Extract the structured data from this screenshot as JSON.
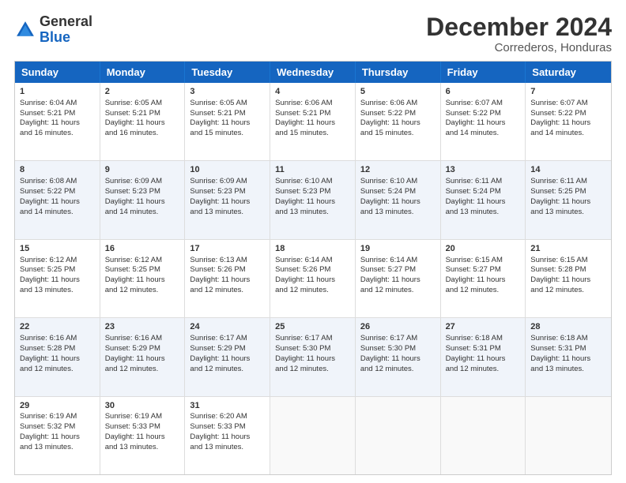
{
  "logo": {
    "general": "General",
    "blue": "Blue"
  },
  "title": "December 2024",
  "location": "Correderos, Honduras",
  "days_of_week": [
    "Sunday",
    "Monday",
    "Tuesday",
    "Wednesday",
    "Thursday",
    "Friday",
    "Saturday"
  ],
  "weeks": [
    [
      {
        "day": 1,
        "lines": [
          "Sunrise: 6:04 AM",
          "Sunset: 5:21 PM",
          "Daylight: 11 hours",
          "and 16 minutes."
        ]
      },
      {
        "day": 2,
        "lines": [
          "Sunrise: 6:05 AM",
          "Sunset: 5:21 PM",
          "Daylight: 11 hours",
          "and 16 minutes."
        ]
      },
      {
        "day": 3,
        "lines": [
          "Sunrise: 6:05 AM",
          "Sunset: 5:21 PM",
          "Daylight: 11 hours",
          "and 15 minutes."
        ]
      },
      {
        "day": 4,
        "lines": [
          "Sunrise: 6:06 AM",
          "Sunset: 5:21 PM",
          "Daylight: 11 hours",
          "and 15 minutes."
        ]
      },
      {
        "day": 5,
        "lines": [
          "Sunrise: 6:06 AM",
          "Sunset: 5:22 PM",
          "Daylight: 11 hours",
          "and 15 minutes."
        ]
      },
      {
        "day": 6,
        "lines": [
          "Sunrise: 6:07 AM",
          "Sunset: 5:22 PM",
          "Daylight: 11 hours",
          "and 14 minutes."
        ]
      },
      {
        "day": 7,
        "lines": [
          "Sunrise: 6:07 AM",
          "Sunset: 5:22 PM",
          "Daylight: 11 hours",
          "and 14 minutes."
        ]
      }
    ],
    [
      {
        "day": 8,
        "lines": [
          "Sunrise: 6:08 AM",
          "Sunset: 5:22 PM",
          "Daylight: 11 hours",
          "and 14 minutes."
        ]
      },
      {
        "day": 9,
        "lines": [
          "Sunrise: 6:09 AM",
          "Sunset: 5:23 PM",
          "Daylight: 11 hours",
          "and 14 minutes."
        ]
      },
      {
        "day": 10,
        "lines": [
          "Sunrise: 6:09 AM",
          "Sunset: 5:23 PM",
          "Daylight: 11 hours",
          "and 13 minutes."
        ]
      },
      {
        "day": 11,
        "lines": [
          "Sunrise: 6:10 AM",
          "Sunset: 5:23 PM",
          "Daylight: 11 hours",
          "and 13 minutes."
        ]
      },
      {
        "day": 12,
        "lines": [
          "Sunrise: 6:10 AM",
          "Sunset: 5:24 PM",
          "Daylight: 11 hours",
          "and 13 minutes."
        ]
      },
      {
        "day": 13,
        "lines": [
          "Sunrise: 6:11 AM",
          "Sunset: 5:24 PM",
          "Daylight: 11 hours",
          "and 13 minutes."
        ]
      },
      {
        "day": 14,
        "lines": [
          "Sunrise: 6:11 AM",
          "Sunset: 5:25 PM",
          "Daylight: 11 hours",
          "and 13 minutes."
        ]
      }
    ],
    [
      {
        "day": 15,
        "lines": [
          "Sunrise: 6:12 AM",
          "Sunset: 5:25 PM",
          "Daylight: 11 hours",
          "and 13 minutes."
        ]
      },
      {
        "day": 16,
        "lines": [
          "Sunrise: 6:12 AM",
          "Sunset: 5:25 PM",
          "Daylight: 11 hours",
          "and 12 minutes."
        ]
      },
      {
        "day": 17,
        "lines": [
          "Sunrise: 6:13 AM",
          "Sunset: 5:26 PM",
          "Daylight: 11 hours",
          "and 12 minutes."
        ]
      },
      {
        "day": 18,
        "lines": [
          "Sunrise: 6:14 AM",
          "Sunset: 5:26 PM",
          "Daylight: 11 hours",
          "and 12 minutes."
        ]
      },
      {
        "day": 19,
        "lines": [
          "Sunrise: 6:14 AM",
          "Sunset: 5:27 PM",
          "Daylight: 11 hours",
          "and 12 minutes."
        ]
      },
      {
        "day": 20,
        "lines": [
          "Sunrise: 6:15 AM",
          "Sunset: 5:27 PM",
          "Daylight: 11 hours",
          "and 12 minutes."
        ]
      },
      {
        "day": 21,
        "lines": [
          "Sunrise: 6:15 AM",
          "Sunset: 5:28 PM",
          "Daylight: 11 hours",
          "and 12 minutes."
        ]
      }
    ],
    [
      {
        "day": 22,
        "lines": [
          "Sunrise: 6:16 AM",
          "Sunset: 5:28 PM",
          "Daylight: 11 hours",
          "and 12 minutes."
        ]
      },
      {
        "day": 23,
        "lines": [
          "Sunrise: 6:16 AM",
          "Sunset: 5:29 PM",
          "Daylight: 11 hours",
          "and 12 minutes."
        ]
      },
      {
        "day": 24,
        "lines": [
          "Sunrise: 6:17 AM",
          "Sunset: 5:29 PM",
          "Daylight: 11 hours",
          "and 12 minutes."
        ]
      },
      {
        "day": 25,
        "lines": [
          "Sunrise: 6:17 AM",
          "Sunset: 5:30 PM",
          "Daylight: 11 hours",
          "and 12 minutes."
        ]
      },
      {
        "day": 26,
        "lines": [
          "Sunrise: 6:17 AM",
          "Sunset: 5:30 PM",
          "Daylight: 11 hours",
          "and 12 minutes."
        ]
      },
      {
        "day": 27,
        "lines": [
          "Sunrise: 6:18 AM",
          "Sunset: 5:31 PM",
          "Daylight: 11 hours",
          "and 12 minutes."
        ]
      },
      {
        "day": 28,
        "lines": [
          "Sunrise: 6:18 AM",
          "Sunset: 5:31 PM",
          "Daylight: 11 hours",
          "and 13 minutes."
        ]
      }
    ],
    [
      {
        "day": 29,
        "lines": [
          "Sunrise: 6:19 AM",
          "Sunset: 5:32 PM",
          "Daylight: 11 hours",
          "and 13 minutes."
        ]
      },
      {
        "day": 30,
        "lines": [
          "Sunrise: 6:19 AM",
          "Sunset: 5:33 PM",
          "Daylight: 11 hours",
          "and 13 minutes."
        ]
      },
      {
        "day": 31,
        "lines": [
          "Sunrise: 6:20 AM",
          "Sunset: 5:33 PM",
          "Daylight: 11 hours",
          "and 13 minutes."
        ]
      },
      null,
      null,
      null,
      null
    ]
  ]
}
